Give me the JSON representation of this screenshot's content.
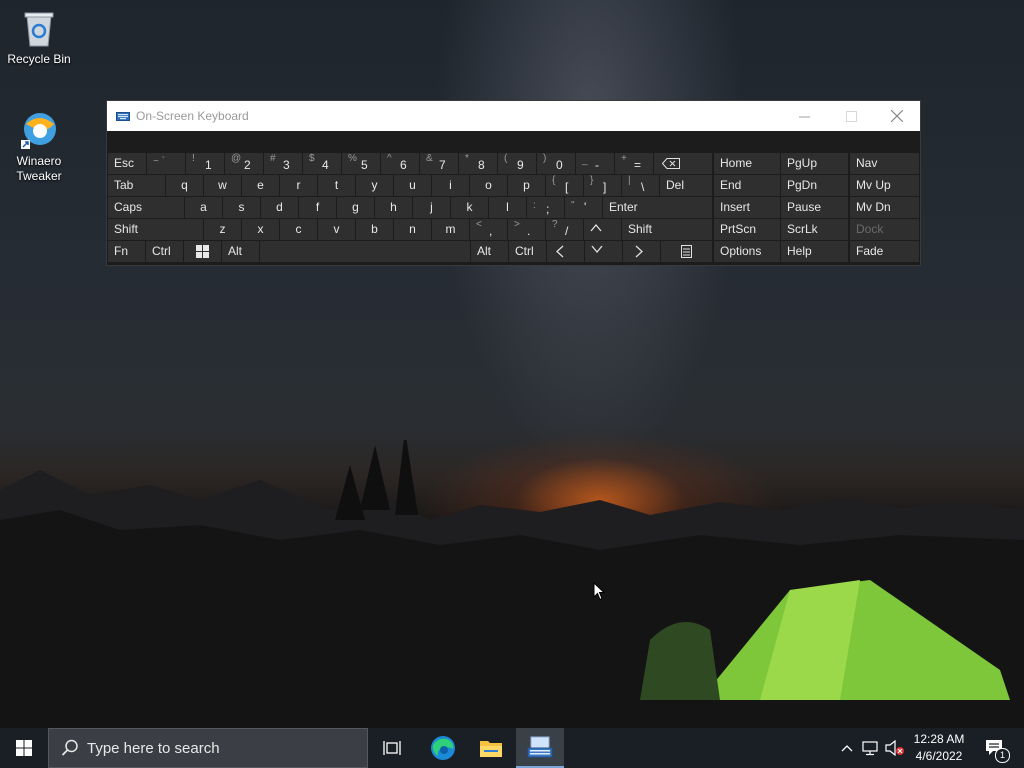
{
  "desktop": {
    "icons": [
      {
        "label": "Recycle Bin"
      },
      {
        "label": "Winaero Tweaker"
      }
    ]
  },
  "osk": {
    "title": "On-Screen Keyboard",
    "rows": {
      "r1": {
        "esc": "Esc",
        "k_tilde": {
          "sym": "~ `",
          "dig": ""
        },
        "k1": {
          "sym": "!",
          "dig": "1"
        },
        "k2": {
          "sym": "@",
          "dig": "2"
        },
        "k3": {
          "sym": "#",
          "dig": "3"
        },
        "k4": {
          "sym": "$",
          "dig": "4"
        },
        "k5": {
          "sym": "%",
          "dig": "5"
        },
        "k6": {
          "sym": "^",
          "dig": "6"
        },
        "k7": {
          "sym": "&",
          "dig": "7"
        },
        "k8": {
          "sym": "*",
          "dig": "8"
        },
        "k9": {
          "sym": "(",
          "dig": "9"
        },
        "k0": {
          "sym": ")",
          "dig": "0"
        },
        "kminus": {
          "sym": "_",
          "dig": "-"
        },
        "kplus": {
          "sym": "+",
          "dig": "="
        }
      },
      "r2": {
        "tab": "Tab",
        "letters": [
          "q",
          "w",
          "e",
          "r",
          "t",
          "y",
          "u",
          "i",
          "o",
          "p"
        ],
        "kbr1": {
          "sym": "{",
          "dig": "["
        },
        "kbr2": {
          "sym": "}",
          "dig": "]"
        },
        "kpipe": {
          "sym": "|",
          "dig": "\\"
        },
        "del": "Del"
      },
      "r3": {
        "caps": "Caps",
        "letters": [
          "a",
          "s",
          "d",
          "f",
          "g",
          "h",
          "j",
          "k",
          "l"
        ],
        "ksemi": {
          "sym": ":",
          "dig": ";"
        },
        "kquote": {
          "sym": "\"",
          "dig": "'"
        },
        "enter": "Enter"
      },
      "r4": {
        "shift": "Shift",
        "letters": [
          "z",
          "x",
          "c",
          "v",
          "b",
          "n",
          "m"
        ],
        "kcomma": {
          "sym": "<",
          "dig": ","
        },
        "kdot": {
          "sym": ">",
          "dig": "."
        },
        "kslash": {
          "sym": "?",
          "dig": "/"
        },
        "shift2": "Shift"
      },
      "r5": {
        "fn": "Fn",
        "ctrl": "Ctrl",
        "alt": "Alt",
        "alt2": "Alt",
        "ctrl2": "Ctrl"
      }
    },
    "nav": {
      "home": "Home",
      "pgup": "PgUp",
      "nav": "Nav",
      "end": "End",
      "pgdn": "PgDn",
      "mvup": "Mv Up",
      "insert": "Insert",
      "pause": "Pause",
      "mvdn": "Mv Dn",
      "prtscn": "PrtScn",
      "scrlk": "ScrLk",
      "dock": "Dock",
      "options": "Options",
      "help": "Help",
      "fade": "Fade"
    }
  },
  "taskbar": {
    "search_placeholder": "Type here to search",
    "clock_time": "12:28 AM",
    "clock_date": "4/6/2022",
    "notification_count": "1"
  }
}
